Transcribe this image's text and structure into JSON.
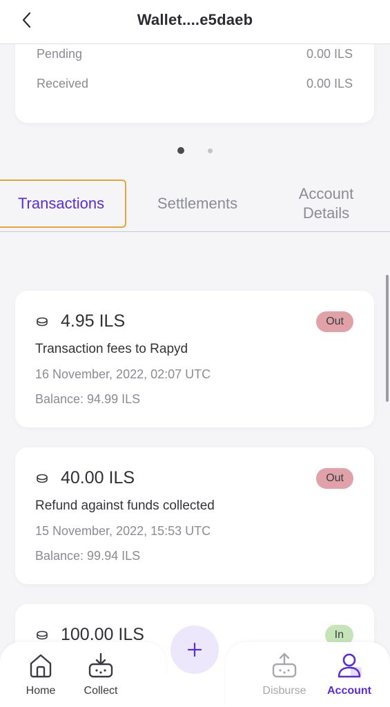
{
  "header": {
    "title": "Wallet....e5daeb",
    "back_icon": "chevron-left-icon"
  },
  "wallet": {
    "rows": [
      {
        "label": "Pending",
        "value": "0.00 ILS"
      },
      {
        "label": "Received",
        "value": "0.00 ILS"
      }
    ],
    "page_indicator": {
      "total": 2,
      "active": 1
    }
  },
  "tabs": [
    {
      "label": "Transactions",
      "active": true
    },
    {
      "label": "Settlements",
      "active": false
    },
    {
      "label": "Account Details",
      "active": false
    }
  ],
  "transactions": [
    {
      "icon": "coin-icon",
      "amount": "4.95 ILS",
      "direction": "Out",
      "description": "Transaction fees to Rapyd",
      "date": "16 November, 2022, 02:07 UTC",
      "balance": "Balance: 94.99 ILS"
    },
    {
      "icon": "coin-icon",
      "amount": "40.00 ILS",
      "direction": "Out",
      "description": "Refund against funds collected",
      "date": "15 November, 2022, 15:53 UTC",
      "balance": "Balance: 99.94 ILS"
    },
    {
      "icon": "coin-icon",
      "amount": "100.00 ILS",
      "direction": "In",
      "description": "",
      "date": "",
      "balance": ""
    }
  ],
  "bottom_nav": {
    "items": [
      {
        "label": "Home",
        "icon": "home-icon",
        "state": "normal"
      },
      {
        "label": "Collect",
        "icon": "collect-icon",
        "state": "normal"
      },
      {
        "label": "Disburse",
        "icon": "disburse-icon",
        "state": "disabled"
      },
      {
        "label": "Account",
        "icon": "user-icon",
        "state": "active"
      }
    ],
    "fab_icon": "plus-icon"
  },
  "colors": {
    "accent": "#5a2bd8",
    "tab_focus_border": "#e6a53a",
    "badge_out": "#e0a2a8",
    "badge_in": "#c5e5b8",
    "background": "#f5f5f7"
  }
}
